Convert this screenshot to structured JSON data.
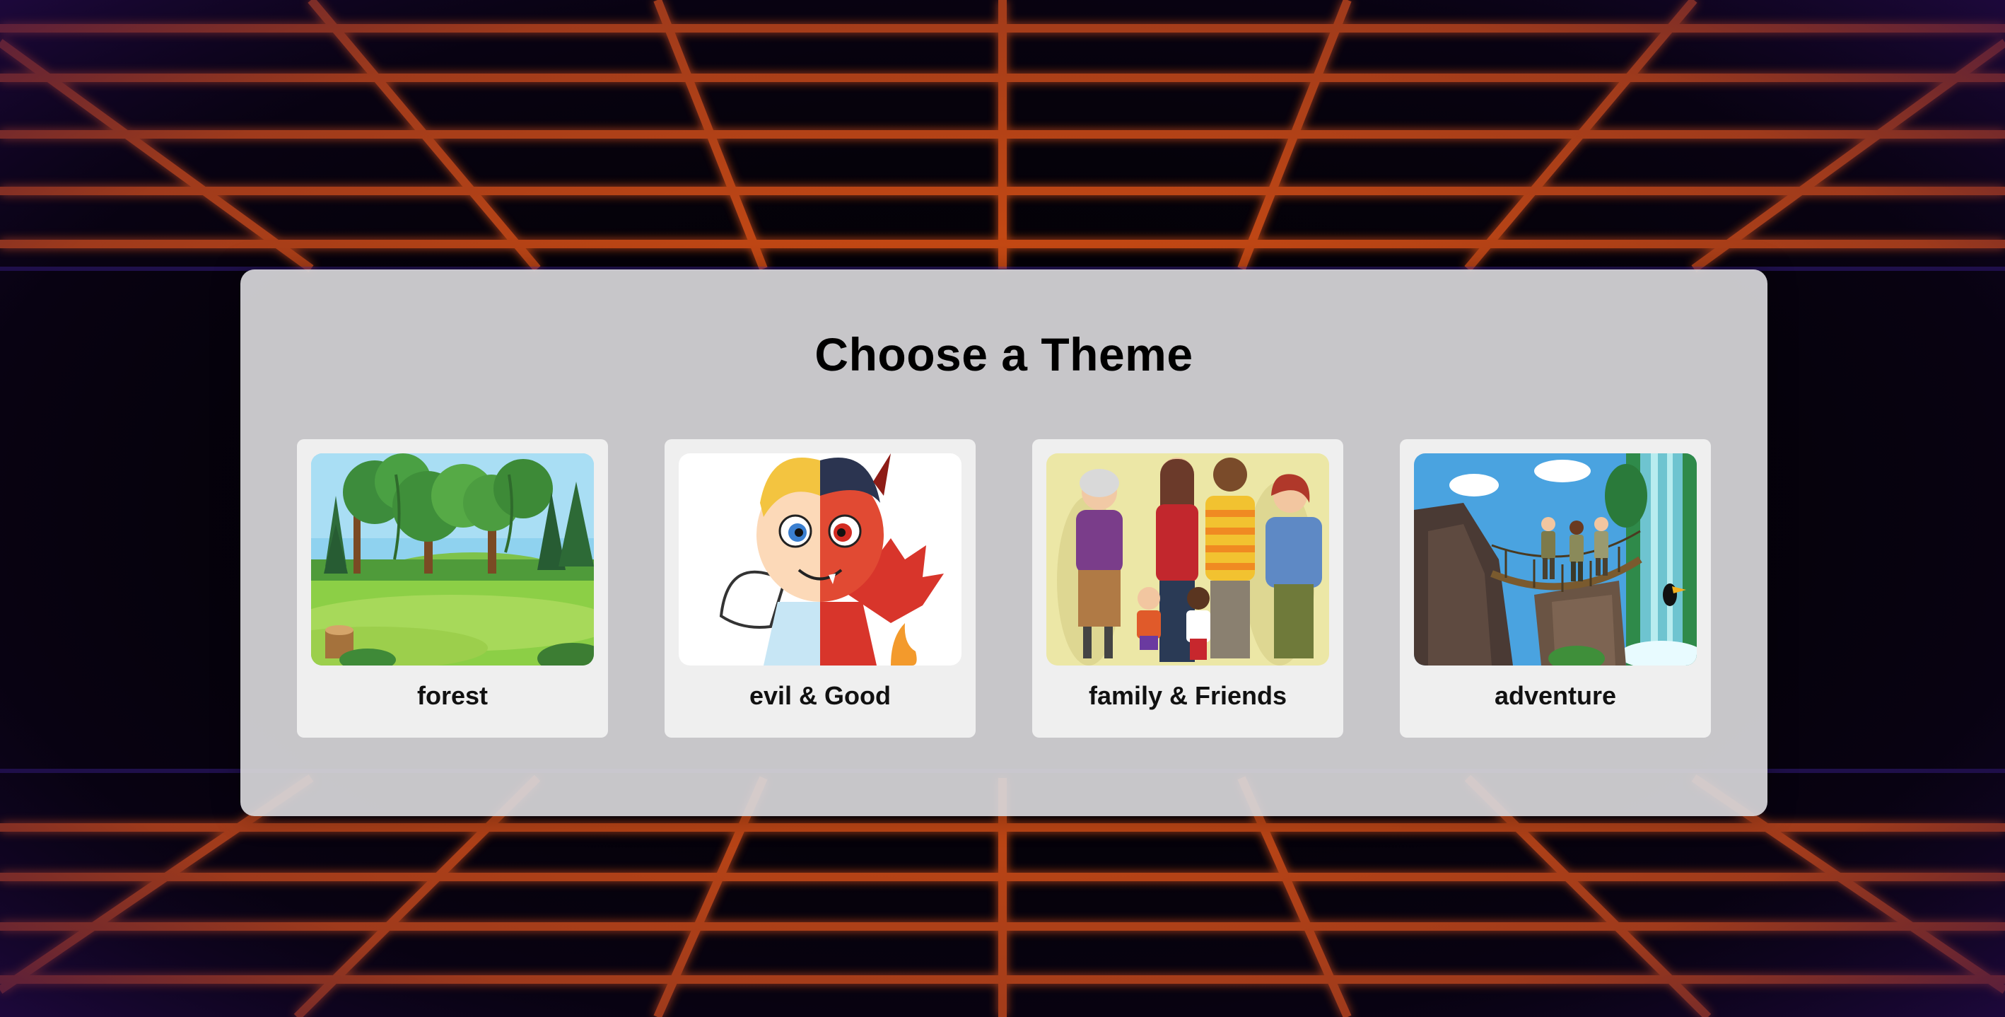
{
  "modal": {
    "title": "Choose a Theme"
  },
  "themes": [
    {
      "label": "forest",
      "icon": "forest-illustration"
    },
    {
      "label": "evil & Good",
      "icon": "angel-devil-illustration"
    },
    {
      "label": "family & Friends",
      "icon": "family-illustration"
    },
    {
      "label": "adventure",
      "icon": "jungle-bridge-illustration"
    }
  ],
  "colors": {
    "background": "#050208",
    "grid_glow": "#ff5a10",
    "panel": "#d6d5d8",
    "card": "#efefef",
    "text": "#000000"
  }
}
